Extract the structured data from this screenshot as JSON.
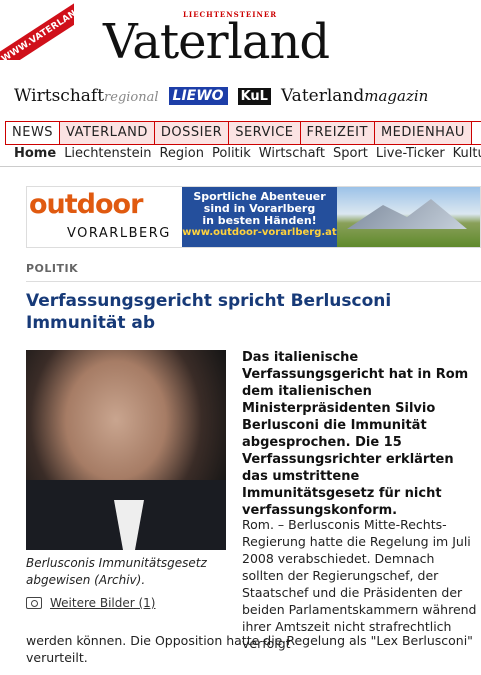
{
  "site": {
    "corner_url": "WWW.VATERLAND.LI",
    "brand_small": "LIECHTENSTEINER",
    "brand": "Vaterland",
    "subbrands": {
      "wirtschaft": "Wirtschaft",
      "wirtschaft_sub": "regional",
      "liewo": "LIEWO",
      "kul": "KuL",
      "vaterland": "Vaterland",
      "vaterland_sub": "magazin"
    }
  },
  "nav": {
    "main": [
      "NEWS",
      "VATERLAND",
      "DOSSIER",
      "SERVICE",
      "FREIZEIT",
      "MEDIENHAU"
    ],
    "sub": [
      "Home",
      "Liechtenstein",
      "Region",
      "Politik",
      "Wirtschaft",
      "Sport",
      "Live-Ticker",
      "Kultu"
    ]
  },
  "banner": {
    "logo_top": "outdoor",
    "logo_bottom": "VORARLBERG",
    "line1": "Sportliche Abenteuer",
    "line2": "sind in Vorarlberg",
    "line3": "in besten Händen!",
    "url": "www.outdoor-vorarlberg.at"
  },
  "article": {
    "section": "POLITIK",
    "headline": "Verfassungsgericht spricht Berlusconi Immunität ab",
    "caption": "Berlusconis Immunitätsgesetz abgewisen (Archiv).",
    "more_images": "Weitere Bilder (1)",
    "lead": "Das italienische Verfassungsgericht hat in Rom dem italienischen Ministerpräsidenten Silvio Berlusconi die Immunität abgesprochen. Die 15 Verfassungsrichter erklärten das umstrittene Immunitätsgesetz für nicht verfassungskonform.",
    "body_right": "Rom. – Berlusconis Mitte-Rechts-Regierung hatte die Regelung im Juli 2008 verabschiedet. Demnach sollten der Regierungschef, der Staatschef und die Präsidenten der beiden Parlamentskammern während ihrer Amtszeit nicht strafrechtlich verfolgt",
    "body_full": "werden können. Die Opposition hatte die Regelung als \"Lex Berlusconi\" verurteilt."
  },
  "colors": {
    "accent_red": "#d0101a",
    "headline_blue": "#173a78",
    "tab_bg": "#fbe3e3"
  }
}
